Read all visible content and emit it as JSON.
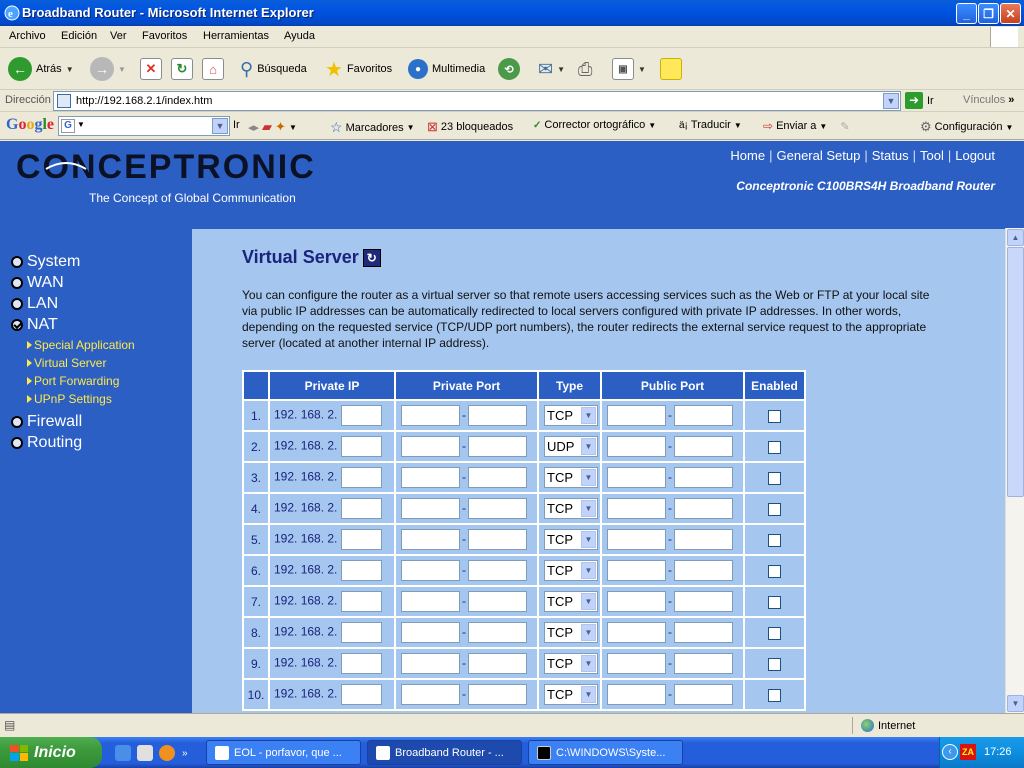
{
  "window": {
    "title": "Broadband Router - Microsoft Internet Explorer"
  },
  "menu": [
    "Archivo",
    "Edición",
    "Ver",
    "Favoritos",
    "Herramientas",
    "Ayuda"
  ],
  "toolbar": {
    "back_label": "Atrás",
    "search_label": "Búsqueda",
    "favorites_label": "Favoritos",
    "multimedia_label": "Multimedia"
  },
  "address": {
    "label": "Dirección",
    "url": "http://192.168.2.1/index.htm",
    "go_label": "Ir",
    "links_label": "Vínculos"
  },
  "googlebar": {
    "logo": "Google",
    "go_label": "Ir",
    "bookmarks_label": "Marcadores",
    "blocked_label": "23 bloqueados",
    "spellcheck_label": "Corrector ortográfico",
    "translate_label": "Traducir",
    "send_label": "Enviar a",
    "settings_label": "Configuración"
  },
  "router": {
    "brand": "CONCEPTRONIC",
    "tagline": "The Concept of Global Communication",
    "model": "Conceptronic C100BRS4H Broadband Router",
    "topnav": [
      "Home",
      "General Setup",
      "Status",
      "Tool",
      "Logout"
    ],
    "sidebar": {
      "main": [
        "System",
        "WAN",
        "LAN",
        "NAT",
        "Firewall",
        "Routing"
      ],
      "nat_sub": [
        "Special Application",
        "Virtual Server",
        "Port Forwarding",
        "UPnP Settings"
      ]
    },
    "page_title": "Virtual Server",
    "description": "You can configure the router as a virtual server so that remote users accessing services such as the Web or FTP at your local site via public IP addresses can be automatically redirected to local servers configured with private IP addresses. In other words, depending on the requested service (TCP/UDP port numbers), the router redirects the external service request to the appropriate server (located at another internal IP address).",
    "table": {
      "headers": [
        "Private IP",
        "Private Port",
        "Type",
        "Public Port",
        "Enabled"
      ],
      "ip_prefix": "192. 168. 2.",
      "rows": [
        {
          "num": "1.",
          "type": "TCP"
        },
        {
          "num": "2.",
          "type": "UDP"
        },
        {
          "num": "3.",
          "type": "TCP"
        },
        {
          "num": "4.",
          "type": "TCP"
        },
        {
          "num": "5.",
          "type": "TCP"
        },
        {
          "num": "6.",
          "type": "TCP"
        },
        {
          "num": "7.",
          "type": "TCP"
        },
        {
          "num": "8.",
          "type": "TCP"
        },
        {
          "num": "9.",
          "type": "TCP"
        },
        {
          "num": "10.",
          "type": "TCP"
        }
      ]
    }
  },
  "statusbar": {
    "zone": "Internet"
  },
  "taskbar": {
    "start_label": "Inicio",
    "tasks": [
      "EOL - porfavor, que ...",
      "Broadband Router - ...",
      "C:\\WINDOWS\\Syste..."
    ],
    "clock": "17:26"
  }
}
